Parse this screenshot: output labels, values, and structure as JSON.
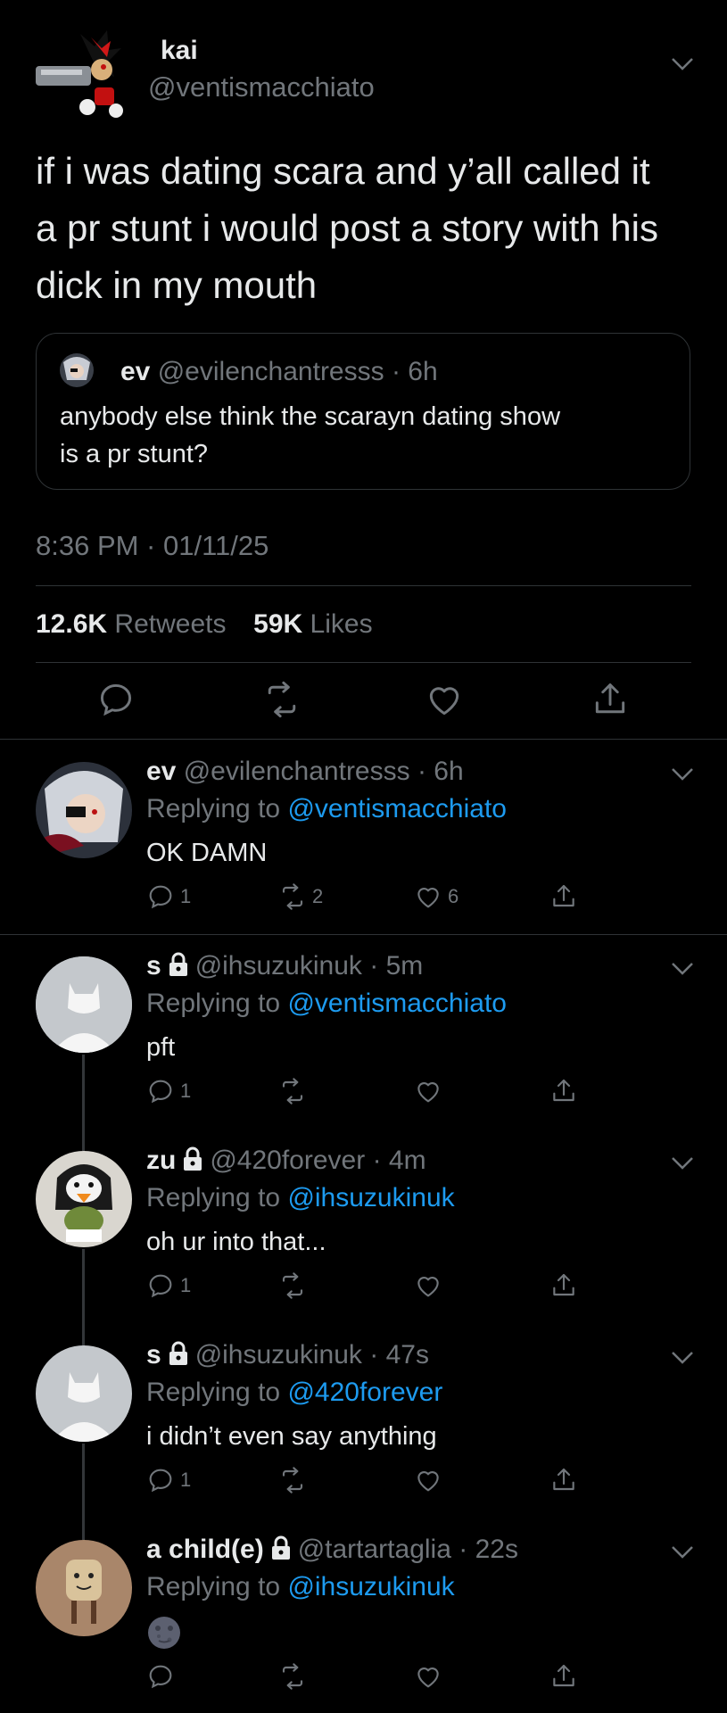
{
  "main_tweet": {
    "name": "kai",
    "handle": "@ventismacchiato",
    "text_lines": [
      "if i was dating scara and y’all called it",
      "a pr stunt i would post a story with his",
      "dick in my mouth"
    ],
    "quote": {
      "name": "ev",
      "handle": "@evilenchantresss",
      "time": "· 6h",
      "text_lines": [
        "anybody else think the scarayn dating show",
        "is a pr stunt?"
      ]
    },
    "timestamp": "8:36 PM · 01/11/25",
    "retweets_count": "12.6K",
    "retweets_label": "Retweets",
    "likes_count": "59K",
    "likes_label": "Likes"
  },
  "replies": [
    {
      "name": "ev",
      "handle": "@evilenchantresss",
      "time": "· 6h",
      "locked": false,
      "replying_label": "Replying to",
      "replying_to": "@ventismacchiato",
      "text": "OK DAMN",
      "reply_count": "1",
      "retweet_count": "2",
      "like_count": "6"
    },
    {
      "name": "s",
      "handle": "@ihsuzukinuk",
      "time": "· 5m",
      "locked": true,
      "replying_label": "Replying to",
      "replying_to": "@ventismacchiato",
      "text": "pft",
      "reply_count": "1",
      "retweet_count": "",
      "like_count": ""
    },
    {
      "name": "zu",
      "handle": "@420forever",
      "time": "· 4m",
      "locked": true,
      "replying_label": "Replying to",
      "replying_to": "@ihsuzukinuk",
      "text": "oh ur into that...",
      "reply_count": "1",
      "retweet_count": "",
      "like_count": ""
    },
    {
      "name": "s",
      "handle": "@ihsuzukinuk",
      "time": "· 47s",
      "locked": true,
      "replying_label": "Replying to",
      "replying_to": "@420forever",
      "text": "i didn’t even say anything",
      "reply_count": "1",
      "retweet_count": "",
      "like_count": ""
    },
    {
      "name": "a child(e)",
      "handle": "@tartartaglia",
      "time": "· 22s",
      "locked": true,
      "replying_label": "Replying to",
      "replying_to": "@ihsuzukinuk",
      "text": "",
      "reply_count": "",
      "retweet_count": "",
      "like_count": ""
    }
  ],
  "icons": {
    "reply": "reply-icon",
    "retweet": "retweet-icon",
    "like": "heart-icon",
    "share": "share-icon",
    "more": "chevron-down-icon",
    "lock": "lock-icon",
    "emoji": "new-moon-face-emoji"
  },
  "colors": {
    "background": "#000000",
    "text": "#e7e9ea",
    "secondary": "#71767b",
    "link": "#1d9bf0",
    "divider": "#2f3336"
  }
}
